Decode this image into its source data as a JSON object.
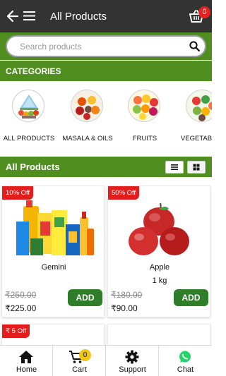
{
  "header": {
    "title": "All Products",
    "cart_count": "0",
    "icons": [
      "back-arrow-icon",
      "menu-icon",
      "cart-icon"
    ]
  },
  "search": {
    "placeholder": "Search products"
  },
  "categories_section": {
    "title": "CATEGORIES",
    "items": [
      {
        "label": "ALL PRODUCTS"
      },
      {
        "label": "MASALA & OILS"
      },
      {
        "label": "FRUITS"
      },
      {
        "label": "VEGETABLES"
      }
    ]
  },
  "products_section": {
    "title": "All Products",
    "view_icons": [
      "list-view-icon",
      "grid-view-icon"
    ],
    "products": [
      {
        "badge": "10% Off",
        "name": "Gemini",
        "unit": "",
        "mrp": "₹250.00",
        "price": "₹225.00",
        "add_label": "ADD"
      },
      {
        "badge": "50% Off",
        "name": "Apple",
        "unit": "1 kg",
        "mrp": "₹180.00",
        "price": "₹90.00",
        "add_label": "ADD"
      },
      {
        "badge": "₹ 5 Off"
      }
    ]
  },
  "bottom_nav": {
    "items": [
      {
        "label": "Home"
      },
      {
        "label": "Cart",
        "badge": "0"
      },
      {
        "label": "Support"
      },
      {
        "label": "Chat"
      }
    ]
  },
  "colors": {
    "header_bg": "#333333",
    "brand_green": "#4f8e1f",
    "add_button": "#2e7d28",
    "discount_badge": "#e31c1c",
    "cart_badge": "#e81f1f",
    "nav_cart_badge": "#f0c419",
    "whatsapp_green": "#25d366"
  }
}
